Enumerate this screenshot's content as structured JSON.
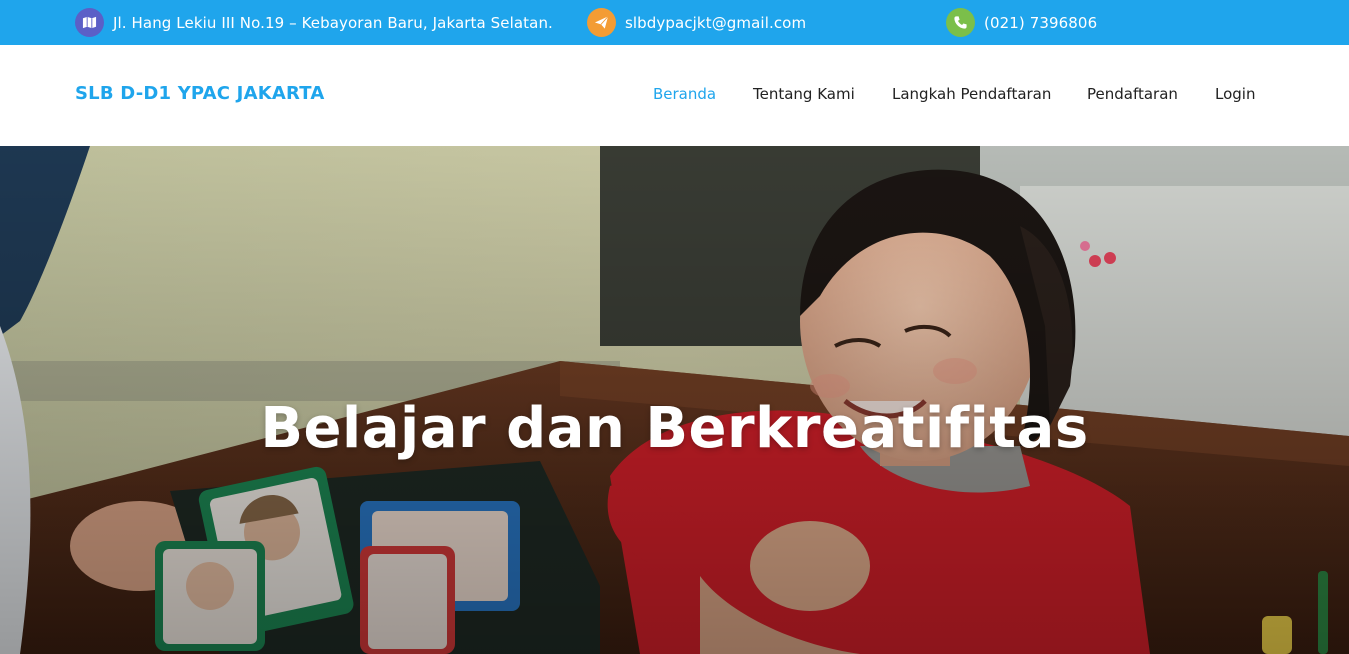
{
  "topbar": {
    "address": {
      "icon": "map-icon",
      "icon_color": "#5b5fc7",
      "text": "Jl. Hang Lekiu III No.19 – Kebayoran Baru, Jakarta Selatan."
    },
    "email": {
      "icon": "paper-plane-icon",
      "icon_color": "#f39c34",
      "text": "slbdypacjkt@gmail.com"
    },
    "phone": {
      "icon": "phone-icon",
      "icon_color": "#7bbf4a",
      "text": "(021) 7396806"
    },
    "background": "#1fa5ec"
  },
  "header": {
    "brand": "SLB D-D1 YPAC JAKARTA",
    "brand_color": "#1fa5ec",
    "nav": [
      {
        "label": "Beranda",
        "active": true
      },
      {
        "label": "Tentang Kami",
        "active": false
      },
      {
        "label": "Langkah Pendaftaran",
        "active": false
      },
      {
        "label": "Pendaftaran",
        "active": false
      },
      {
        "label": "Login",
        "active": false
      }
    ]
  },
  "hero": {
    "title": "Belajar dan Berkreatifitas",
    "image": "hero-photo-child-learning-with-picture-cards"
  }
}
